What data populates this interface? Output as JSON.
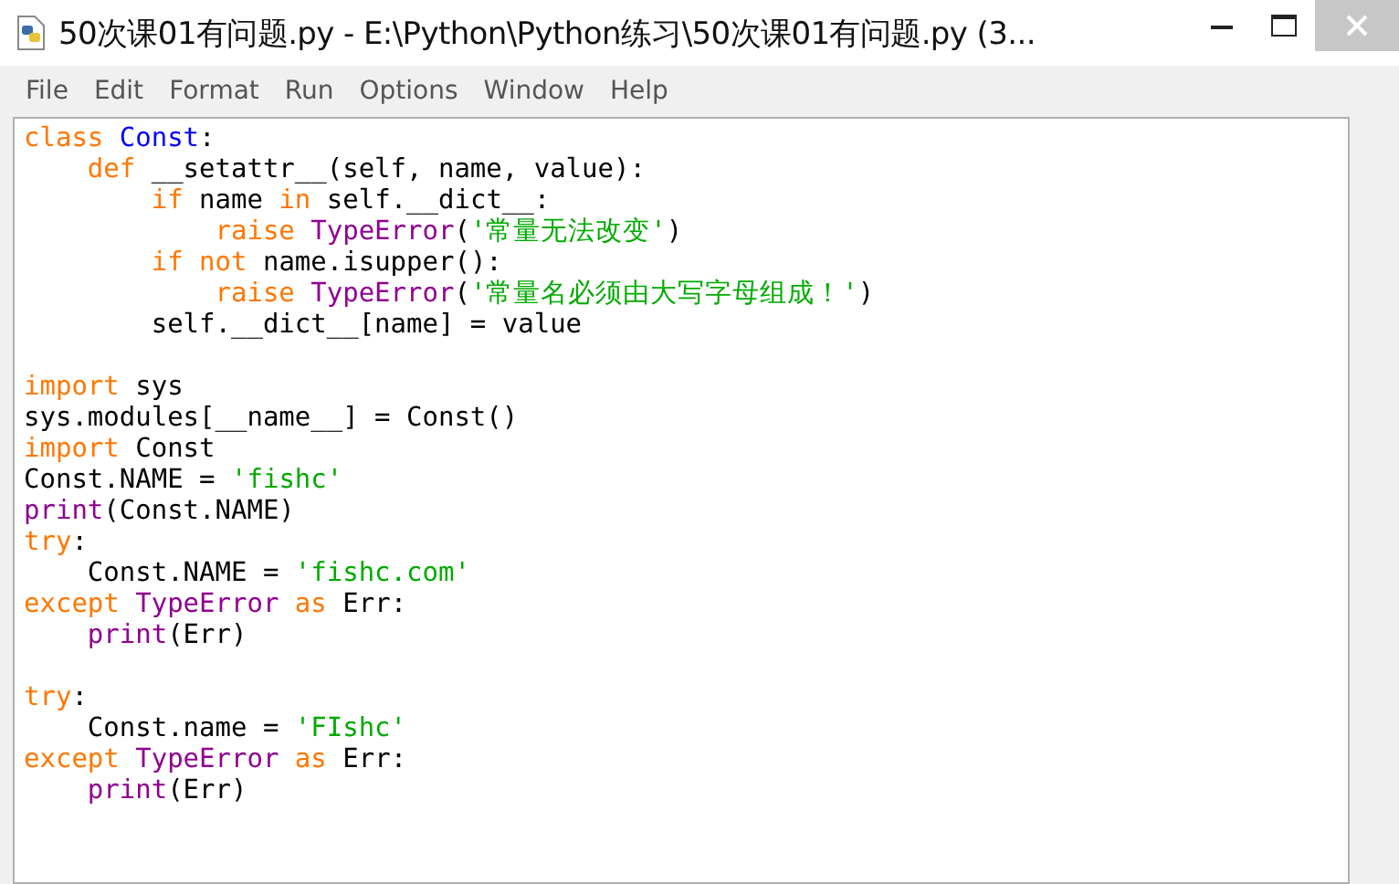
{
  "window": {
    "title": "50次课01有问题.py - E:\\Python\\Python练习\\50次课01有问题.py (3..."
  },
  "menu": [
    "File",
    "Edit",
    "Format",
    "Run",
    "Options",
    "Window",
    "Help"
  ],
  "editor": {
    "lines": [
      {
        "kind": "code",
        "tokens": [
          {
            "kind": "keyword",
            "text": "class"
          },
          {
            "kind": "definition",
            "text": " Const"
          },
          {
            "kind": "plain",
            "text": ":"
          }
        ]
      },
      {
        "kind": "code",
        "tokens": [
          {
            "kind": "keyword",
            "text": "    def"
          },
          {
            "kind": "plain",
            "text": " __setattr__(self, name, value):"
          }
        ]
      },
      {
        "kind": "code",
        "tokens": [
          {
            "kind": "keyword",
            "text": "        if"
          },
          {
            "kind": "plain",
            "text": " name "
          },
          {
            "kind": "keyword",
            "text": "in"
          },
          {
            "kind": "plain",
            "text": " self.__dict__:"
          }
        ]
      },
      {
        "kind": "code",
        "tokens": [
          {
            "kind": "keyword",
            "text": "            raise"
          },
          {
            "kind": "builtin",
            "text": " TypeError"
          },
          {
            "kind": "plain",
            "text": "("
          },
          {
            "kind": "string",
            "text": "'常量无法改变'"
          },
          {
            "kind": "plain",
            "text": ")"
          }
        ]
      },
      {
        "kind": "code",
        "tokens": [
          {
            "kind": "keyword",
            "text": "        if"
          },
          {
            "kind": "keyword",
            "text": " not"
          },
          {
            "kind": "plain",
            "text": " name.isupper():"
          }
        ]
      },
      {
        "kind": "code",
        "tokens": [
          {
            "kind": "keyword",
            "text": "            raise"
          },
          {
            "kind": "builtin",
            "text": " TypeError"
          },
          {
            "kind": "plain",
            "text": "("
          },
          {
            "kind": "string",
            "text": "'常量名必须由大写字母组成！'"
          },
          {
            "kind": "plain",
            "text": ")"
          }
        ]
      },
      {
        "kind": "code",
        "tokens": [
          {
            "kind": "plain",
            "text": "        self.__dict__[name] = value"
          }
        ]
      },
      {
        "kind": "blank"
      },
      {
        "kind": "code",
        "tokens": [
          {
            "kind": "keyword",
            "text": "import"
          },
          {
            "kind": "plain",
            "text": " sys"
          }
        ]
      },
      {
        "kind": "code",
        "tokens": [
          {
            "kind": "plain",
            "text": "sys.modules[__name__] = Const()"
          }
        ]
      },
      {
        "kind": "code",
        "tokens": [
          {
            "kind": "keyword",
            "text": "import"
          },
          {
            "kind": "plain",
            "text": " Const"
          }
        ]
      },
      {
        "kind": "code",
        "tokens": [
          {
            "kind": "plain",
            "text": "Const.NAME = "
          },
          {
            "kind": "string",
            "text": "'fishc'"
          }
        ]
      },
      {
        "kind": "code",
        "tokens": [
          {
            "kind": "builtin",
            "text": "print"
          },
          {
            "kind": "plain",
            "text": "(Const.NAME)"
          }
        ]
      },
      {
        "kind": "code",
        "tokens": [
          {
            "kind": "keyword",
            "text": "try"
          },
          {
            "kind": "plain",
            "text": ":"
          }
        ]
      },
      {
        "kind": "code",
        "tokens": [
          {
            "kind": "plain",
            "text": "    Const.NAME = "
          },
          {
            "kind": "string",
            "text": "'fishc.com'"
          }
        ]
      },
      {
        "kind": "code",
        "tokens": [
          {
            "kind": "keyword",
            "text": "except"
          },
          {
            "kind": "builtin",
            "text": " TypeError"
          },
          {
            "kind": "keyword",
            "text": " as"
          },
          {
            "kind": "plain",
            "text": " Err:"
          }
        ]
      },
      {
        "kind": "code",
        "tokens": [
          {
            "kind": "builtin",
            "text": "    print"
          },
          {
            "kind": "plain",
            "text": "(Err)"
          }
        ]
      },
      {
        "kind": "blank"
      },
      {
        "kind": "code",
        "tokens": [
          {
            "kind": "keyword",
            "text": "try"
          },
          {
            "kind": "plain",
            "text": ":"
          }
        ]
      },
      {
        "kind": "code",
        "tokens": [
          {
            "kind": "plain",
            "text": "    Const.name = "
          },
          {
            "kind": "string",
            "text": "'FIshc'"
          }
        ]
      },
      {
        "kind": "code",
        "tokens": [
          {
            "kind": "keyword",
            "text": "except"
          },
          {
            "kind": "builtin",
            "text": " TypeError"
          },
          {
            "kind": "keyword",
            "text": " as"
          },
          {
            "kind": "plain",
            "text": " Err:"
          }
        ]
      },
      {
        "kind": "code",
        "tokens": [
          {
            "kind": "builtin",
            "text": "    print"
          },
          {
            "kind": "plain",
            "text": "(Err)"
          }
        ]
      }
    ]
  }
}
